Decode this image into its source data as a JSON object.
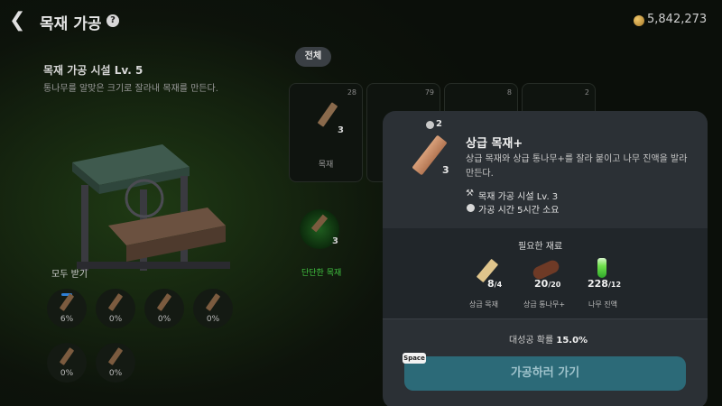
{
  "header": {
    "back_glyph": "❮",
    "title": "목재 가공",
    "help_glyph": "?",
    "gold": "5,842,273"
  },
  "facility": {
    "title": "목재 가공 시설 Lv. 5",
    "description": "통나무를 알맞은 크기로 잘라내 목재를 만든다."
  },
  "slots": {
    "receive_all": "모두 받기",
    "items": [
      {
        "percent": "6%",
        "progress": 0.06
      },
      {
        "percent": "0%",
        "progress": 0
      },
      {
        "percent": "0%",
        "progress": 0
      },
      {
        "percent": "0%",
        "progress": 0
      },
      {
        "percent": "0%",
        "progress": 0
      },
      {
        "percent": "0%",
        "progress": 0
      }
    ]
  },
  "filter": {
    "all": "전체"
  },
  "cards": [
    {
      "badge": "28",
      "qty": "3",
      "name": "목재"
    },
    {
      "badge": "79",
      "qty": "",
      "name": ""
    },
    {
      "badge": "8",
      "qty": "",
      "name": ""
    },
    {
      "badge": "2",
      "qty": "",
      "name": ""
    }
  ],
  "glow_item": {
    "qty": "3",
    "name": "단단한 목재"
  },
  "detail": {
    "owned": "2",
    "qty": "3",
    "name": "상급 목재+",
    "description": "상급 목재와 상급 통나무+를 잘라 붙이고 나무 진액을 발라 만든다.",
    "facility": "목재 가공 시설 Lv. 3",
    "time": "가공 시간 5시간 소요",
    "required_title": "필요한 재료",
    "materials": [
      {
        "have": "8",
        "need": "/4",
        "name": "상급 목재"
      },
      {
        "have": "20",
        "need": "/20",
        "name": "상급 통나무+"
      },
      {
        "have": "228",
        "need": "/12",
        "name": "나무 진액"
      }
    ],
    "success_prefix": "대성공 확률 ",
    "success_rate": "15.0%",
    "button_label": "가공하러 가기",
    "space_key": "Space"
  },
  "colors": {
    "background": "#0d130b",
    "modal": "#2b3035",
    "button": "#2c6a78",
    "accent_green": "#40c040",
    "progress_blue": "#2e7fd6"
  },
  "icons": {
    "back": "chevron-left-icon",
    "help": "question-icon",
    "gold": "coin-icon",
    "facility": "hammer-icon",
    "time": "clock-icon"
  }
}
